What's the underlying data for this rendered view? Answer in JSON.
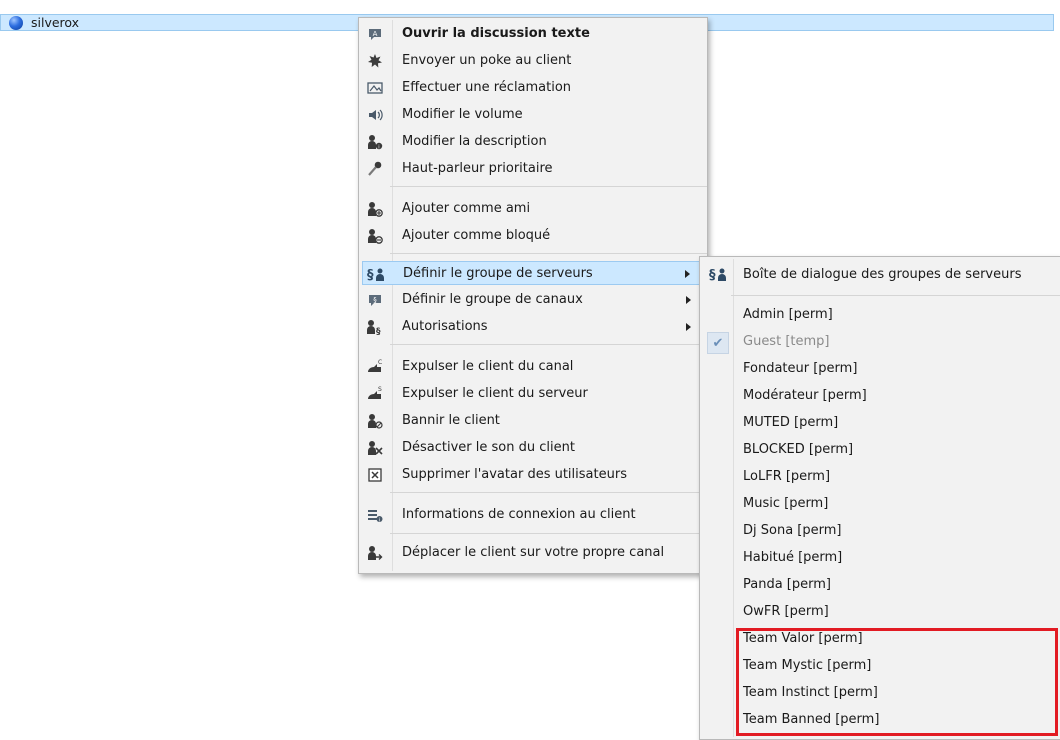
{
  "client": {
    "name": "silverox"
  },
  "context_menu": {
    "items": [
      {
        "label": "Ouvrir la discussion texte",
        "icon": "chat-bubble-icon",
        "bold": true,
        "underline_char": "O"
      },
      {
        "label": "Envoyer un poke au client",
        "icon": "poke-star-icon",
        "underline_char": "p"
      },
      {
        "label": "Effectuer une réclamation",
        "icon": "complaint-icon"
      },
      {
        "label": "Modifier le volume",
        "icon": "speaker-volume-icon",
        "underline_char": "v"
      },
      {
        "label": "Modifier la description",
        "icon": "user-info-icon",
        "underline_char": "cr"
      },
      {
        "label": "Haut-parleur prioritaire",
        "icon": "microphone-icon",
        "underline_char": "p"
      },
      {
        "label": "Ajouter comme ami",
        "icon": "user-add-friend-icon"
      },
      {
        "label": "Ajouter comme bloqué",
        "icon": "user-block-icon"
      },
      {
        "label": "Définir le groupe de serveurs",
        "icon": "server-group-icon",
        "submenu": true
      },
      {
        "label": "Définir le groupe de canaux",
        "icon": "channel-group-icon",
        "submenu": true
      },
      {
        "label": "Autorisations",
        "icon": "permissions-icon",
        "submenu": true
      },
      {
        "label": "Expulser le client du canal",
        "icon": "kick-channel-icon",
        "underline_char": "E"
      },
      {
        "label": "Expulser le client du serveur",
        "icon": "kick-server-icon",
        "underline_char": "E"
      },
      {
        "label": "Bannir le client",
        "icon": "ban-icon",
        "underline_char": "B"
      },
      {
        "label": "Désactiver le son du client",
        "icon": "mute-client-icon"
      },
      {
        "label": "Supprimer l'avatar des utilisateurs",
        "icon": "delete-avatar-icon"
      },
      {
        "label": "Informations de connexion au client",
        "icon": "connection-info-icon",
        "underline_char": "c"
      },
      {
        "label": "Déplacer le client sur votre propre canal",
        "icon": "move-client-icon",
        "underline_char": "D"
      }
    ]
  },
  "server_group_submenu": {
    "dialog_label": "Boîte de dialogue des groupes de serveurs",
    "groups": [
      {
        "label": "Admin [perm]"
      },
      {
        "label": "Guest [temp]",
        "checked": true,
        "disabled": true
      },
      {
        "label": "Fondateur [perm]"
      },
      {
        "label": "Modérateur [perm]"
      },
      {
        "label": "MUTED [perm]"
      },
      {
        "label": "BLOCKED [perm]"
      },
      {
        "label": "LoLFR [perm]"
      },
      {
        "label": "Music [perm]"
      },
      {
        "label": "Dj Sona [perm]"
      },
      {
        "label": "Habitué [perm]"
      },
      {
        "label": "Panda [perm]"
      },
      {
        "label": "OwFR [perm]"
      },
      {
        "label": "Team Valor [perm]"
      },
      {
        "label": "Team Mystic [perm]"
      },
      {
        "label": "Team Instinct [perm]"
      },
      {
        "label": "Team Banned [perm]"
      }
    ]
  },
  "colors": {
    "highlight": "#cce8ff",
    "annotation_box": "#e21b23",
    "menu_bg": "#f2f2f2"
  }
}
